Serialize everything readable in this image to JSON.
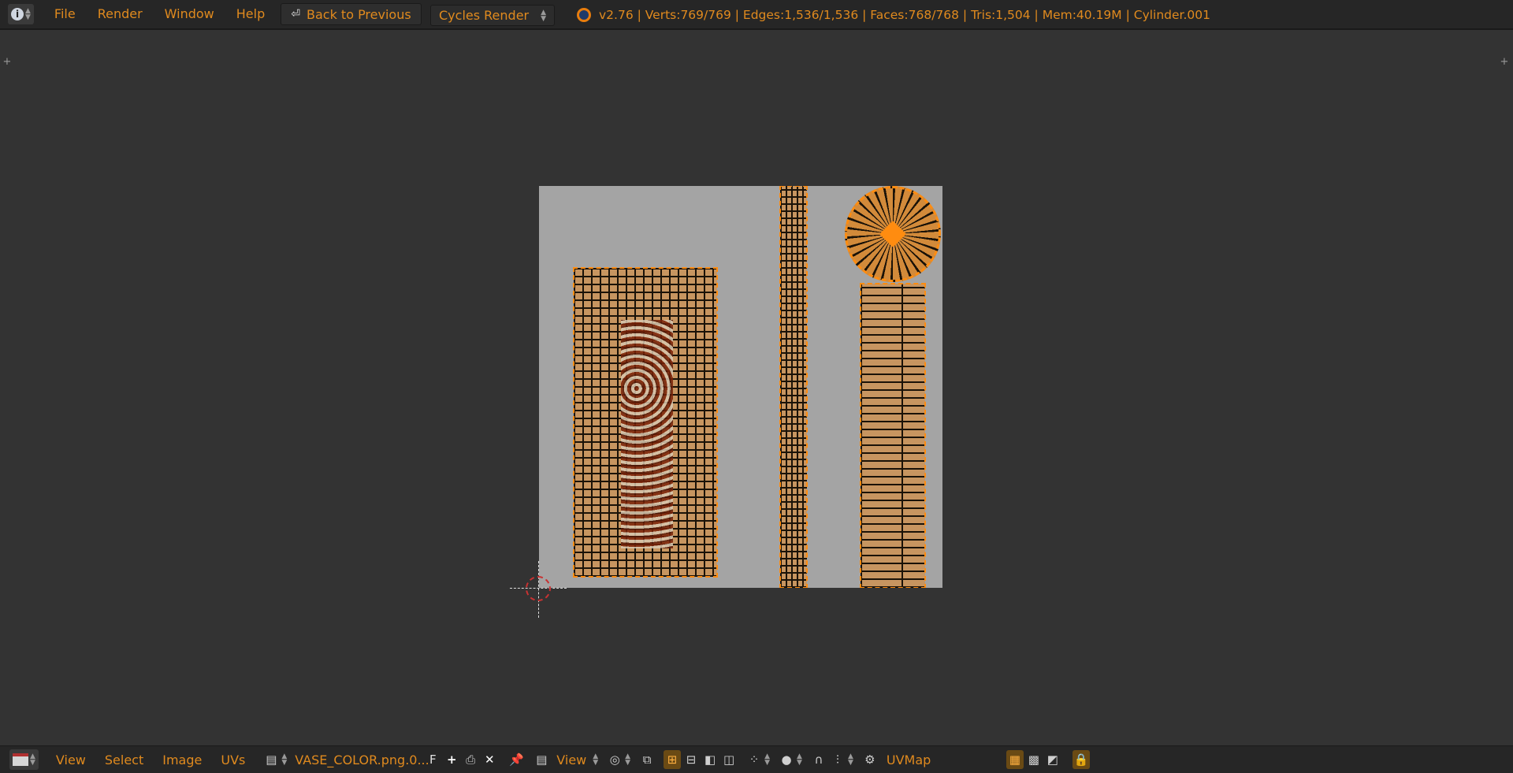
{
  "top": {
    "info_icon": "info-icon",
    "menu": [
      "File",
      "Render",
      "Window",
      "Help"
    ],
    "back_label": "Back to Previous",
    "engine": "Cycles Render",
    "stats": "v2.76 | Verts:769/769 | Edges:1,536/1,536 | Faces:768/768 | Tris:1,504 | Mem:40.19M | Cylinder.001"
  },
  "bottom": {
    "menu": [
      "View",
      "Select",
      "Image",
      "UVs"
    ],
    "image_name": "VASE_COLOR.png.0...",
    "fake_user": "F",
    "view_label": "View",
    "uvmap": "UVMap"
  },
  "colors": {
    "accent": "#e08a1e",
    "background": "#333333",
    "header": "#262626"
  }
}
